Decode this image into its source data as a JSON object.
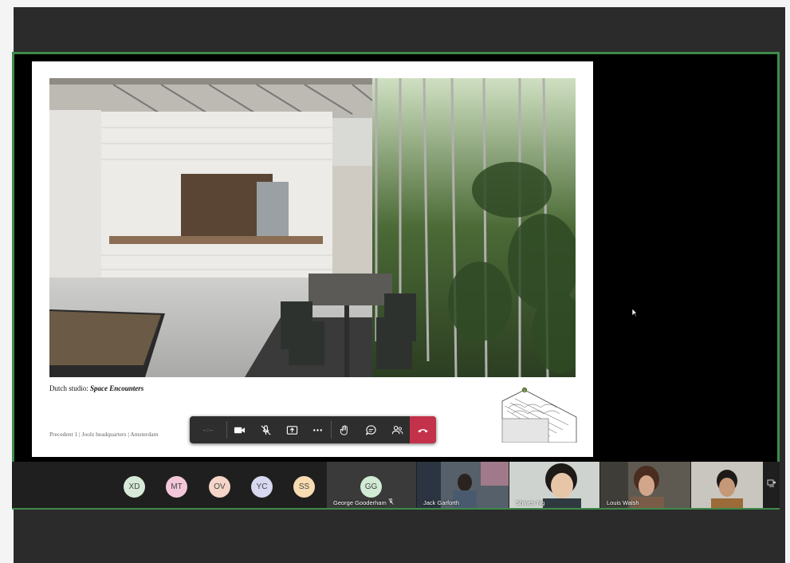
{
  "slide": {
    "caption_prefix": "Dutch studio: ",
    "caption_name": "Space Encounters",
    "footer": "Precedent 1 | Joolz headquarters | Amsterdam",
    "sketch_marker": "1"
  },
  "toolbar": {
    "timer": "--:--",
    "buttons": [
      "camera-icon",
      "mic-off-icon",
      "share-tray-icon",
      "more-icon",
      "raise-hand-icon",
      "chat-icon",
      "people-icon",
      "hangup-icon"
    ],
    "hangup_color": "#c4314b"
  },
  "participants": {
    "avatars": [
      {
        "initials": "XD",
        "color": "#d7ead9"
      },
      {
        "initials": "MT",
        "color": "#f3c7d9"
      },
      {
        "initials": "OV",
        "color": "#f5d5c8"
      },
      {
        "initials": "YC",
        "color": "#d8d8f1"
      },
      {
        "initials": "SS",
        "color": "#f7dcb2"
      }
    ],
    "gg": {
      "initials": "GG",
      "name": "George Gooderham",
      "color": "#d2ebd5"
    },
    "video_tiles": [
      {
        "name": "Jack Garforth"
      },
      {
        "name": "Shiwen Ng"
      },
      {
        "name": "Louis Walsh"
      },
      {
        "name": ""
      }
    ]
  },
  "colors": {
    "frame_border": "#3f8a4a",
    "app_background": "#2b2b2b"
  }
}
